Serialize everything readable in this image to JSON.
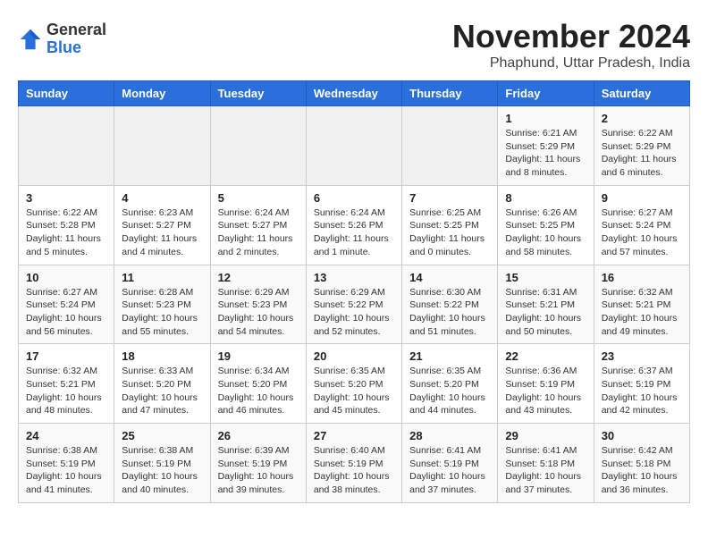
{
  "header": {
    "logo": {
      "general": "General",
      "blue": "Blue"
    },
    "title": "November 2024",
    "subtitle": "Phaphund, Uttar Pradesh, India"
  },
  "weekdays": [
    "Sunday",
    "Monday",
    "Tuesday",
    "Wednesday",
    "Thursday",
    "Friday",
    "Saturday"
  ],
  "weeks": [
    [
      {
        "day": "",
        "info": ""
      },
      {
        "day": "",
        "info": ""
      },
      {
        "day": "",
        "info": ""
      },
      {
        "day": "",
        "info": ""
      },
      {
        "day": "",
        "info": ""
      },
      {
        "day": "1",
        "info": "Sunrise: 6:21 AM\nSunset: 5:29 PM\nDaylight: 11 hours and 8 minutes."
      },
      {
        "day": "2",
        "info": "Sunrise: 6:22 AM\nSunset: 5:29 PM\nDaylight: 11 hours and 6 minutes."
      }
    ],
    [
      {
        "day": "3",
        "info": "Sunrise: 6:22 AM\nSunset: 5:28 PM\nDaylight: 11 hours and 5 minutes."
      },
      {
        "day": "4",
        "info": "Sunrise: 6:23 AM\nSunset: 5:27 PM\nDaylight: 11 hours and 4 minutes."
      },
      {
        "day": "5",
        "info": "Sunrise: 6:24 AM\nSunset: 5:27 PM\nDaylight: 11 hours and 2 minutes."
      },
      {
        "day": "6",
        "info": "Sunrise: 6:24 AM\nSunset: 5:26 PM\nDaylight: 11 hours and 1 minute."
      },
      {
        "day": "7",
        "info": "Sunrise: 6:25 AM\nSunset: 5:25 PM\nDaylight: 11 hours and 0 minutes."
      },
      {
        "day": "8",
        "info": "Sunrise: 6:26 AM\nSunset: 5:25 PM\nDaylight: 10 hours and 58 minutes."
      },
      {
        "day": "9",
        "info": "Sunrise: 6:27 AM\nSunset: 5:24 PM\nDaylight: 10 hours and 57 minutes."
      }
    ],
    [
      {
        "day": "10",
        "info": "Sunrise: 6:27 AM\nSunset: 5:24 PM\nDaylight: 10 hours and 56 minutes."
      },
      {
        "day": "11",
        "info": "Sunrise: 6:28 AM\nSunset: 5:23 PM\nDaylight: 10 hours and 55 minutes."
      },
      {
        "day": "12",
        "info": "Sunrise: 6:29 AM\nSunset: 5:23 PM\nDaylight: 10 hours and 54 minutes."
      },
      {
        "day": "13",
        "info": "Sunrise: 6:29 AM\nSunset: 5:22 PM\nDaylight: 10 hours and 52 minutes."
      },
      {
        "day": "14",
        "info": "Sunrise: 6:30 AM\nSunset: 5:22 PM\nDaylight: 10 hours and 51 minutes."
      },
      {
        "day": "15",
        "info": "Sunrise: 6:31 AM\nSunset: 5:21 PM\nDaylight: 10 hours and 50 minutes."
      },
      {
        "day": "16",
        "info": "Sunrise: 6:32 AM\nSunset: 5:21 PM\nDaylight: 10 hours and 49 minutes."
      }
    ],
    [
      {
        "day": "17",
        "info": "Sunrise: 6:32 AM\nSunset: 5:21 PM\nDaylight: 10 hours and 48 minutes."
      },
      {
        "day": "18",
        "info": "Sunrise: 6:33 AM\nSunset: 5:20 PM\nDaylight: 10 hours and 47 minutes."
      },
      {
        "day": "19",
        "info": "Sunrise: 6:34 AM\nSunset: 5:20 PM\nDaylight: 10 hours and 46 minutes."
      },
      {
        "day": "20",
        "info": "Sunrise: 6:35 AM\nSunset: 5:20 PM\nDaylight: 10 hours and 45 minutes."
      },
      {
        "day": "21",
        "info": "Sunrise: 6:35 AM\nSunset: 5:20 PM\nDaylight: 10 hours and 44 minutes."
      },
      {
        "day": "22",
        "info": "Sunrise: 6:36 AM\nSunset: 5:19 PM\nDaylight: 10 hours and 43 minutes."
      },
      {
        "day": "23",
        "info": "Sunrise: 6:37 AM\nSunset: 5:19 PM\nDaylight: 10 hours and 42 minutes."
      }
    ],
    [
      {
        "day": "24",
        "info": "Sunrise: 6:38 AM\nSunset: 5:19 PM\nDaylight: 10 hours and 41 minutes."
      },
      {
        "day": "25",
        "info": "Sunrise: 6:38 AM\nSunset: 5:19 PM\nDaylight: 10 hours and 40 minutes."
      },
      {
        "day": "26",
        "info": "Sunrise: 6:39 AM\nSunset: 5:19 PM\nDaylight: 10 hours and 39 minutes."
      },
      {
        "day": "27",
        "info": "Sunrise: 6:40 AM\nSunset: 5:19 PM\nDaylight: 10 hours and 38 minutes."
      },
      {
        "day": "28",
        "info": "Sunrise: 6:41 AM\nSunset: 5:19 PM\nDaylight: 10 hours and 37 minutes."
      },
      {
        "day": "29",
        "info": "Sunrise: 6:41 AM\nSunset: 5:18 PM\nDaylight: 10 hours and 37 minutes."
      },
      {
        "day": "30",
        "info": "Sunrise: 6:42 AM\nSunset: 5:18 PM\nDaylight: 10 hours and 36 minutes."
      }
    ]
  ]
}
